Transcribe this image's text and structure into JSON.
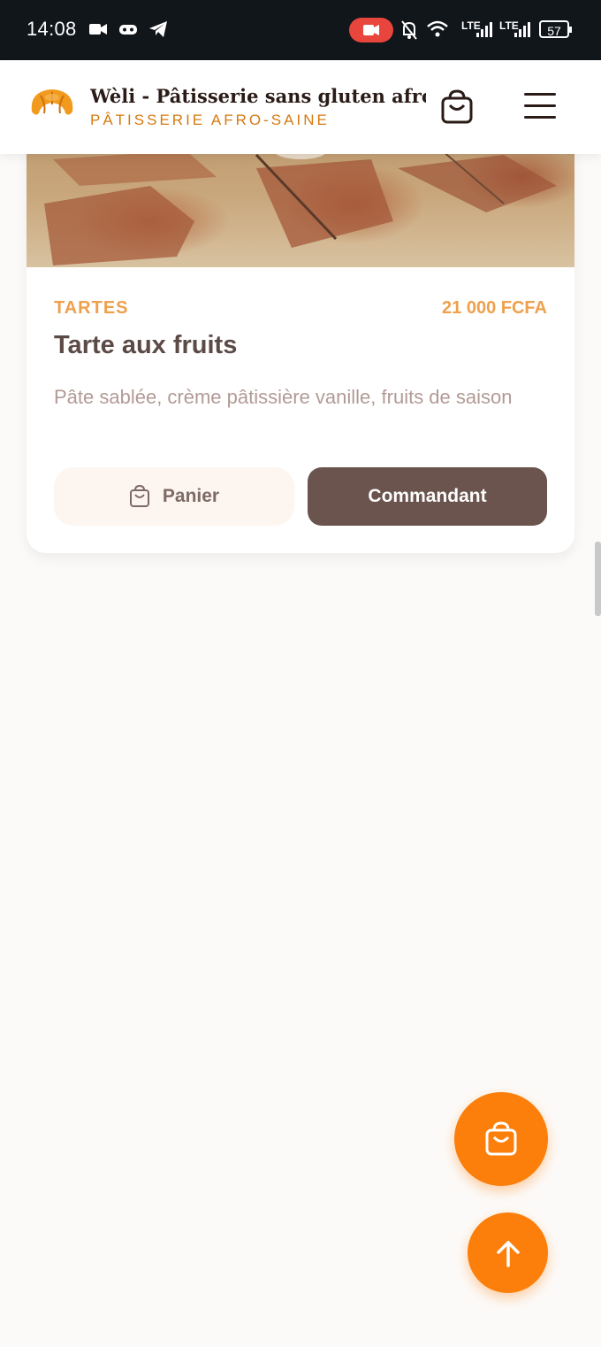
{
  "status_bar": {
    "time": "14:08",
    "network_labels": [
      "LTE",
      "LTE"
    ],
    "battery": "57"
  },
  "header": {
    "site_title": "Wèli - Pâtisserie sans gluten afro-...",
    "site_subtitle": "PÂTISSERIE AFRO-SAINE",
    "cart_icon": "shopping-bag-icon",
    "menu_icon": "hamburger-menu-icon",
    "logo_icon": "croissant-icon"
  },
  "product": {
    "category": "TARTES",
    "price": "21 000 FCFA",
    "title": "Tarte aux fruits",
    "description": "Pâte sablée, crème pâtissière vanille, fruits de saison",
    "add_to_cart_label": "Panier",
    "order_label": "Commandant"
  },
  "fabs": {
    "cart_icon": "shopping-bag-icon",
    "scroll_top_icon": "arrow-up-icon"
  },
  "colors": {
    "accent": "#fb7f0a",
    "brand_brown": "#6a544d",
    "category_orange": "#efa04d",
    "subtitle_orange": "#d67a10"
  }
}
